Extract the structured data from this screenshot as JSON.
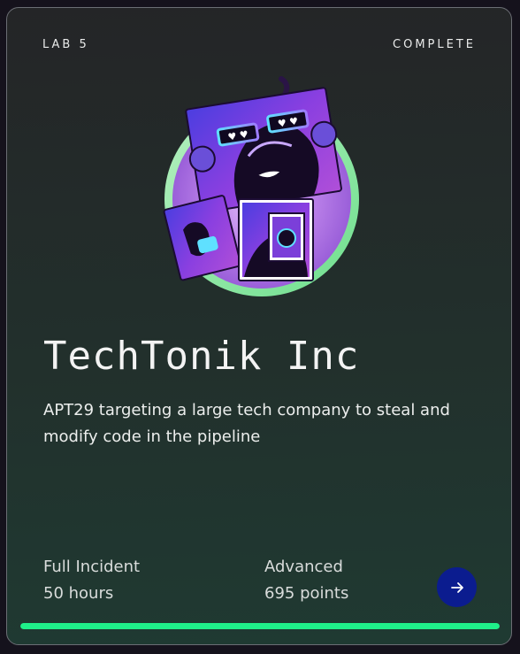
{
  "card": {
    "lab_label": "LAB 5",
    "status": "COMPLETE",
    "title": "TechTonik Inc",
    "description": "APT29 targeting a large tech company to steal and modify code in the pipeline",
    "incident_type": "Full Incident",
    "duration": "50 hours",
    "difficulty": "Advanced",
    "points": "695 points",
    "progress_fraction": 1.0,
    "button_icon": "arrow-right-icon",
    "badge_icon": "lab-badge-artwork",
    "colors": {
      "accent_progress": "#1ff08a",
      "button": "#0b1c8f",
      "badge_ring": "#8fe6a3",
      "badge_purple": "#7b3fd9"
    }
  }
}
